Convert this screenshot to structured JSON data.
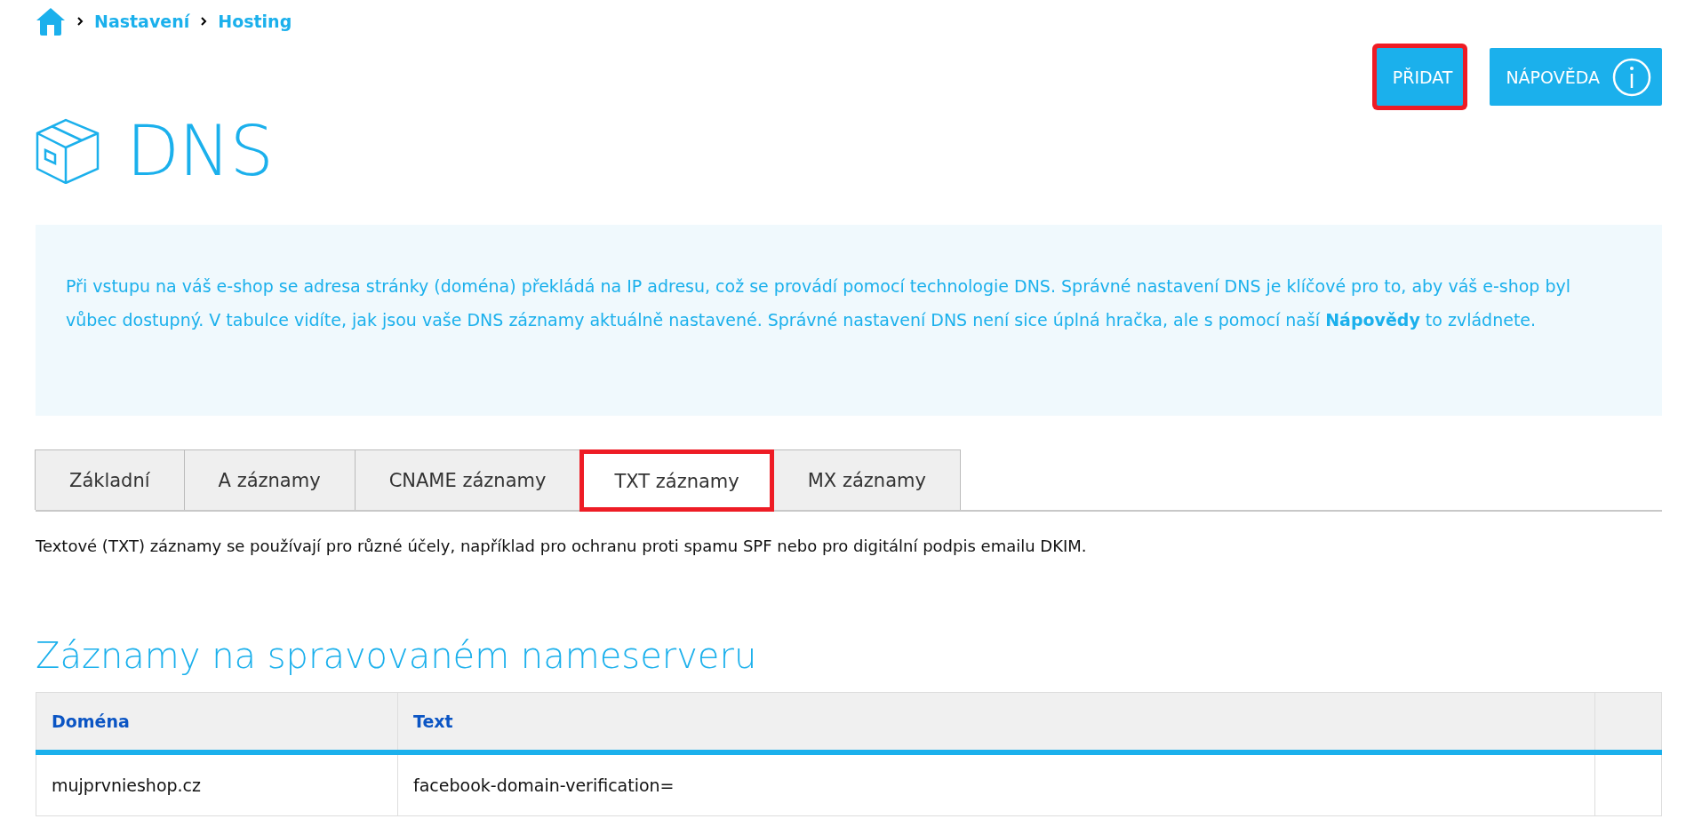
{
  "breadcrumb": {
    "items": [
      "Nastavení",
      "Hosting"
    ]
  },
  "actions": [
    {
      "label": "PŘIDAT",
      "kind": "plain",
      "highlighted": true
    },
    {
      "label": "NÁPOVĚDA",
      "kind": "info",
      "highlighted": false
    }
  ],
  "title": "DNS",
  "info": "Při vstupu na váš e-shop se adresa stránky (doména) překládá na IP adresu, což se provádí pomocí technologie DNS. Správné nastavení DNS je klíčové pro to, aby váš e-shop byl vůbec dostupný. V tabulce vidíte, jak jsou vaše DNS záznamy aktuálně nastavené. Správné nastavení DNS není sice úplná hračka, ale s pomocí naší **Nápovědy** to zvládnete.",
  "tabs": [
    {
      "label": "Základní",
      "selected": false,
      "highlighted": false
    },
    {
      "label": "A záznamy",
      "selected": false,
      "highlighted": false
    },
    {
      "label": "CNAME záznamy",
      "selected": false,
      "highlighted": false
    },
    {
      "label": "TXT záznamy",
      "selected": true,
      "highlighted": true
    },
    {
      "label": "MX záznamy",
      "selected": false,
      "highlighted": false
    }
  ],
  "tab_description": "Textové (TXT) záznamy se používají pro různé účely, například pro ochranu proti spamu SPF nebo pro digitální podpis emailu DKIM.",
  "section_title": "Záznamy na spravovaném nameserveru",
  "table": {
    "columns": [
      "Doména",
      "Text"
    ],
    "rows": [
      [
        "mujprvnieshop.cz",
        "facebook-domain-verification="
      ]
    ]
  }
}
